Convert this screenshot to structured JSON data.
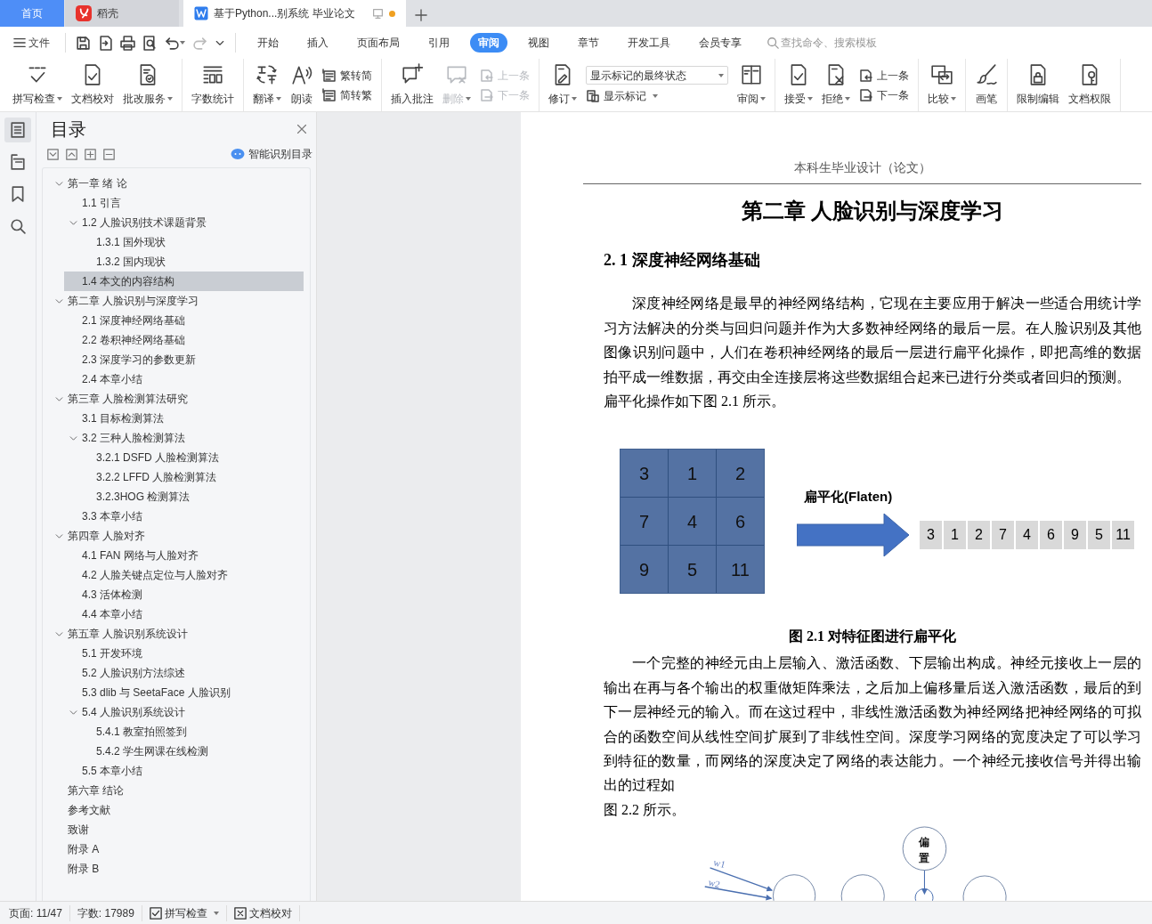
{
  "tabs": [
    {
      "kind": "home",
      "label": "首页",
      "selected": false
    },
    {
      "kind": "app",
      "label": "稻壳",
      "selected": false
    },
    {
      "kind": "document",
      "label": "基于Python...别系统 毕业论文",
      "selected": true,
      "unsaved": true
    }
  ],
  "menu": {
    "file_label": "文件",
    "quick_access": [
      {
        "disabled": false
      },
      {
        "disabled": false
      },
      {
        "disabled": false
      },
      {
        "disabled": false
      },
      {
        "disabled": false,
        "dropdown": true
      },
      {
        "disabled": true
      }
    ],
    "tabs": [
      {
        "label": "开始",
        "selected": false
      },
      {
        "label": "插入",
        "selected": false
      },
      {
        "label": "页面布局",
        "selected": false
      },
      {
        "label": "引用",
        "selected": false
      },
      {
        "label": "审阅",
        "selected": true
      },
      {
        "label": "视图",
        "selected": false
      },
      {
        "label": "章节",
        "selected": false
      },
      {
        "label": "开发工具",
        "selected": false
      },
      {
        "label": "会员专享",
        "selected": false
      }
    ],
    "search_placeholder": "查找命令、搜索模板"
  },
  "ribbon": [
    {
      "items": [
        {
          "kind": "large",
          "label": "拼写检查",
          "dropdown": true,
          "disabled": false
        },
        {
          "kind": "large",
          "label": "文档校对",
          "dropdown": false,
          "disabled": false
        },
        {
          "kind": "large",
          "label": "批改服务",
          "dropdown": true,
          "disabled": false
        }
      ]
    },
    {
      "items": [
        {
          "kind": "large",
          "label": "字数统计",
          "dropdown": false,
          "disabled": false
        }
      ]
    },
    {
      "items": [
        {
          "kind": "large",
          "label": "翻译",
          "dropdown": true,
          "disabled": false
        },
        {
          "kind": "large",
          "label": "朗读",
          "dropdown": false,
          "disabled": false
        },
        {
          "kind": "stack",
          "items": [
            {
              "kind": "small",
              "label": "繁转简",
              "dropdown": false,
              "disabled": false
            },
            {
              "kind": "small",
              "label": "简转繁",
              "dropdown": false,
              "disabled": false
            }
          ]
        }
      ]
    },
    {
      "items": [
        {
          "kind": "large",
          "label": "插入批注",
          "dropdown": false,
          "disabled": false
        },
        {
          "kind": "large",
          "label": "删除",
          "dropdown": true,
          "disabled": true
        },
        {
          "kind": "stack",
          "items": [
            {
              "kind": "small",
              "label": "上一条",
              "dropdown": false,
              "disabled": true
            },
            {
              "kind": "small",
              "label": "下一条",
              "dropdown": false,
              "disabled": true
            }
          ]
        }
      ]
    },
    {
      "items": [
        {
          "kind": "large",
          "label": "修订",
          "dropdown": true,
          "disabled": false
        },
        {
          "kind": "stack",
          "items": [
            {
              "kind": "select",
              "value": "显示标记的最终状态"
            },
            {
              "kind": "small",
              "label": "显示标记",
              "dropdown": true,
              "disabled": false
            }
          ]
        },
        {
          "kind": "large",
          "label": "审阅",
          "dropdown": true,
          "disabled": false
        }
      ]
    },
    {
      "items": [
        {
          "kind": "large",
          "label": "接受",
          "dropdown": true,
          "disabled": false
        },
        {
          "kind": "large",
          "label": "拒绝",
          "dropdown": true,
          "disabled": false
        },
        {
          "kind": "stack",
          "items": [
            {
              "kind": "small",
              "label": "上一条",
              "dropdown": false,
              "disabled": false
            },
            {
              "kind": "small",
              "label": "下一条",
              "dropdown": false,
              "disabled": false
            }
          ]
        }
      ]
    },
    {
      "items": [
        {
          "kind": "large",
          "label": "比较",
          "dropdown": true,
          "disabled": false
        }
      ]
    },
    {
      "items": [
        {
          "kind": "large",
          "label": "画笔",
          "dropdown": false,
          "disabled": false
        }
      ]
    },
    {
      "items": [
        {
          "kind": "large",
          "label": "限制编辑",
          "dropdown": false,
          "disabled": false
        },
        {
          "kind": "large",
          "label": "文档权限",
          "dropdown": false,
          "disabled": false
        }
      ]
    }
  ],
  "side_tools": [
    {
      "selected": true
    },
    {
      "selected": false
    },
    {
      "selected": false
    },
    {
      "selected": false
    }
  ],
  "toc": {
    "title": "目录",
    "smart_button": "智能识别目录",
    "items": [
      {
        "label": "第一章 绪 论",
        "selected": false,
        "expanded": true,
        "children": [
          {
            "label": "1.1  引言",
            "selected": false
          },
          {
            "label": "1.2  人脸识别技术课题背景",
            "selected": false,
            "expanded": true,
            "children": [
              {
                "label": "1.3.1  国外现状",
                "selected": false
              },
              {
                "label": "1.3.2  国内现状",
                "selected": false
              }
            ]
          },
          {
            "label": "1.4  本文的内容结构",
            "selected": true
          }
        ]
      },
      {
        "label": "第二章  人脸识别与深度学习",
        "selected": false,
        "expanded": true,
        "children": [
          {
            "label": "2.1 深度神经网络基础",
            "selected": false
          },
          {
            "label": "2.2 卷积神经网络基础",
            "selected": false
          },
          {
            "label": "2.3  深度学习的参数更新",
            "selected": false
          },
          {
            "label": "2.4 本章小结",
            "selected": false
          }
        ]
      },
      {
        "label": "第三章  人脸检测算法研究",
        "selected": false,
        "expanded": true,
        "children": [
          {
            "label": "3.1 目标检测算法",
            "selected": false
          },
          {
            "label": "3.2 三种人脸检测算法",
            "selected": false,
            "expanded": true,
            "children": [
              {
                "label": "3.2.1 DSFD 人脸检测算法",
                "selected": false
              },
              {
                "label": "3.2.2 LFFD 人脸检测算法",
                "selected": false
              },
              {
                "label": "3.2.3HOG 检测算法",
                "selected": false
              }
            ]
          },
          {
            "label": "3.3  本章小结",
            "selected": false
          }
        ]
      },
      {
        "label": "第四章  人脸对齐",
        "selected": false,
        "expanded": true,
        "children": [
          {
            "label": "4.1 FAN 网络与人脸对齐",
            "selected": false
          },
          {
            "label": "4.2 人脸关键点定位与人脸对齐",
            "selected": false
          },
          {
            "label": "4.3 活体检测",
            "selected": false
          },
          {
            "label": "4.4  本章小结",
            "selected": false
          }
        ]
      },
      {
        "label": "第五章  人脸识别系统设计",
        "selected": false,
        "expanded": true,
        "children": [
          {
            "label": "5.1  开发环境",
            "selected": false
          },
          {
            "label": "5.2 人脸识别方法综述",
            "selected": false
          },
          {
            "label": "5.3 dlib 与 SeetaFace 人脸识别",
            "selected": false
          },
          {
            "label": "5.4  人脸识别系统设计",
            "selected": false,
            "expanded": true,
            "children": [
              {
                "label": "5.4.1  教室拍照签到",
                "selected": false
              },
              {
                "label": "5.4.2  学生网课在线检测",
                "selected": false
              }
            ]
          },
          {
            "label": "5.5 本章小结",
            "selected": false
          }
        ]
      },
      {
        "label": "第六章  结论",
        "selected": false
      },
      {
        "label": "参考文献",
        "selected": false
      },
      {
        "label": "致谢",
        "selected": false
      },
      {
        "label": "附录 A",
        "selected": false
      },
      {
        "label": "附录 B",
        "selected": false
      }
    ]
  },
  "document": {
    "header": "本科生毕业设计（论文）",
    "title": "第二章  人脸识别与深度学习",
    "heading": "2. 1 深度神经网络基础",
    "paragraphs": [
      {
        "text": "深度神经网络是最早的神经网络结构，它现在主要应用于解决一些适合用统计学习方法解决的分类与回归问题并作为大多数神经网络的最后一层。在人脸识别及其他图像识别问题中，人们在卷积神经网络的最后一层进行扁平化操作，即把高维的数据拍平成一维数据，再交由全连接层将这些数据组合起来已进行分类或者回归的预测。",
        "indent": true
      },
      {
        "text": "扁平化操作如下图 2.1 所示。",
        "indent": false
      }
    ],
    "figure": {
      "grid": [
        [
          "3",
          "1",
          "2"
        ],
        [
          "7",
          "4",
          "6"
        ],
        [
          "9",
          "5",
          "11"
        ]
      ],
      "arrow_label": "扁平化(Flaten)",
      "flattened": [
        "3",
        "1",
        "2",
        "7",
        "4",
        "6",
        "9",
        "5",
        "11"
      ],
      "caption": "图 2.1  对特征图进行扁平化"
    },
    "paragraphs_after": [
      {
        "text": "一个完整的神经元由上层输入、激活函数、下层输出构成。神经元接收上一层的输出在再与各个输出的权重做矩阵乘法，之后加上偏移量后送入激活函数，最后的到下一层神经元的输入。而在这过程中，非线性激活函数为神经网络把神经网络的可拟合的函数空间从线性空间扩展到了非线性空间。深度学习网络的宽度决定了可以学习到特征的数量，而网络的深度决定了网络的表达能力。一个神经元接收信号并得出输出的过程如",
        "indent": true
      },
      {
        "text": "图 2.2 所示。",
        "indent": false
      }
    ],
    "diagram": {
      "weights": [
        "w1",
        "w2"
      ],
      "bias_label": [
        "偏",
        "置"
      ]
    }
  },
  "status_bar": {
    "page": "页面: 11/47",
    "words": "字数: 17989",
    "spell_check": "拼写检查",
    "proofread": "文档校对"
  }
}
